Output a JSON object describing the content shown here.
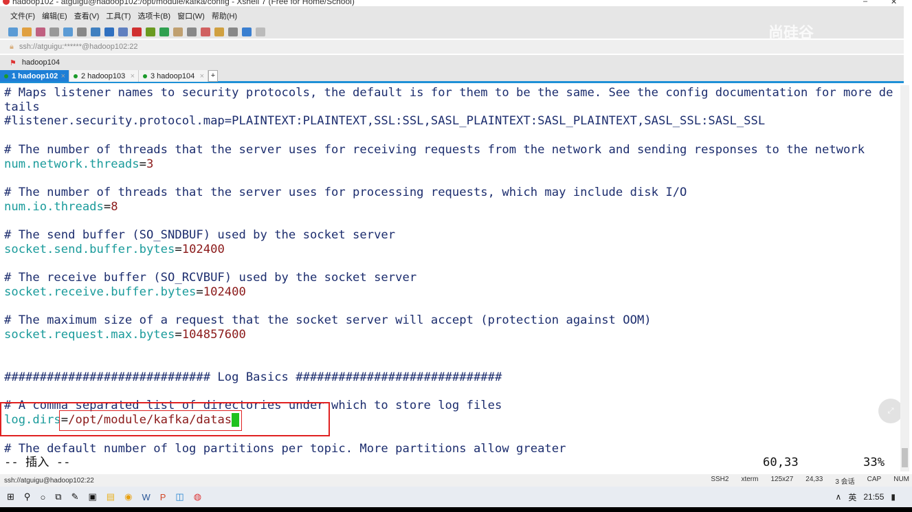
{
  "window": {
    "title": "hadoop102 - atguigu@hadoop102:/opt/module/kafka/config - Xshell 7 (Free for Home/School)",
    "minimize": "–",
    "maximize": "☐",
    "close": "✕"
  },
  "menu": [
    "文件(F)",
    "编辑(E)",
    "查看(V)",
    "工具(T)",
    "选项卡(B)",
    "窗口(W)",
    "帮助(H)"
  ],
  "toolbar_colors": [
    "#5b9bd5",
    "#e0a040",
    "#c06080",
    "#999",
    "#5b9bd5",
    "#888",
    "#4080c0",
    "#3070c0",
    "#6080c0",
    "#d03030",
    "#6a9a20",
    "#30a050",
    "#c0a070",
    "#888",
    "#d06060",
    "#d0a040",
    "#888",
    "#3a7fd0",
    "#bbb"
  ],
  "address": "ssh://atguigu:******@hadoop102:22",
  "session_label": "hadoop104",
  "watermark": "尚硅谷",
  "tabs": [
    {
      "label": "1 hadoop102",
      "active": true
    },
    {
      "label": "2 hadoop103"
    },
    {
      "label": "3 hadoop104"
    }
  ],
  "tab_add": "+",
  "terminal": {
    "lines": [
      [
        [
          "c",
          "# Maps listener names to security protocols, the default is for them to be the same. See the config documentation for more de"
        ]
      ],
      [
        [
          "c",
          "tails"
        ]
      ],
      [
        [
          "c",
          "#listener.security.protocol.map=PLAINTEXT:PLAINTEXT,SSL:SSL,SASL_PLAINTEXT:SASL_PLAINTEXT,SASL_SSL:SASL_SSL"
        ]
      ],
      [],
      [
        [
          "c",
          "# The number of threads that the server uses for receiving requests from the network and sending responses to the network"
        ]
      ],
      [
        [
          "k",
          "num.network.threads"
        ],
        [
          "",
          "="
        ],
        [
          "v",
          "3"
        ]
      ],
      [],
      [
        [
          "c",
          "# The number of threads that the server uses for processing requests, which may include disk I/O"
        ]
      ],
      [
        [
          "k",
          "num.io.threads"
        ],
        [
          "",
          "="
        ],
        [
          "v",
          "8"
        ]
      ],
      [],
      [
        [
          "c",
          "# The send buffer (SO_SNDBUF) used by the socket server"
        ]
      ],
      [
        [
          "k",
          "socket.send.buffer.bytes"
        ],
        [
          "",
          "="
        ],
        [
          "v",
          "102400"
        ]
      ],
      [],
      [
        [
          "c",
          "# The receive buffer (SO_RCVBUF) used by the socket server"
        ]
      ],
      [
        [
          "k",
          "socket.receive.buffer.bytes"
        ],
        [
          "",
          "="
        ],
        [
          "v",
          "102400"
        ]
      ],
      [],
      [
        [
          "c",
          "# The maximum size of a request that the socket server will accept (protection against OOM)"
        ]
      ],
      [
        [
          "k",
          "socket.request.max.bytes"
        ],
        [
          "",
          "="
        ],
        [
          "v",
          "104857600"
        ]
      ],
      [],
      [],
      [
        [
          "c",
          "############################# Log Basics #############################"
        ]
      ],
      [],
      [
        [
          "c",
          "# A comma separated list of directories under which to store log files"
        ]
      ],
      [
        [
          "k",
          "log.dirs"
        ],
        [
          "",
          "="
        ],
        [
          "v",
          "/opt/module/kafka/datas"
        ],
        [
          "cursor",
          " "
        ]
      ],
      [],
      [
        [
          "c",
          "# The default number of log partitions per topic. More partitions allow greater"
        ]
      ]
    ],
    "mode": "-- 插入 --",
    "position": "60,33",
    "percent": "33%"
  },
  "status": {
    "left": "ssh://atguigu@hadoop102:22",
    "items": [
      "SSH2",
      "xterm",
      "125x27",
      "24,33",
      "3 会话",
      "CAP",
      "NUM"
    ]
  },
  "taskbar": {
    "clock": "21:55",
    "ime": "英",
    "volume": "ば",
    "apps": [
      "start",
      "search",
      "cortana",
      "taskview",
      "app1",
      "app2",
      "explorer",
      "chrome",
      "word",
      "powerpoint",
      "virtualbox",
      "xshell"
    ]
  }
}
